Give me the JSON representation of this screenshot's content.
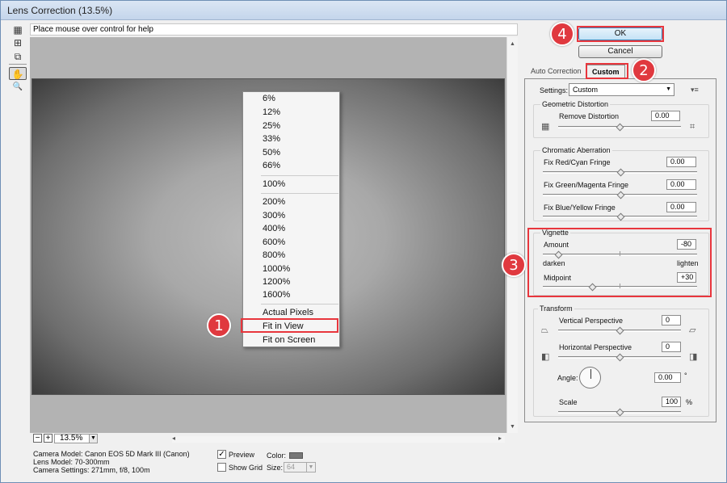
{
  "window": {
    "title": "Lens Correction (13.5%)"
  },
  "help": {
    "text": "Place mouse over control for help"
  },
  "tools": [
    {
      "icon": "remove-distortion-icon",
      "glyph": "▦"
    },
    {
      "icon": "straighten-icon",
      "glyph": "⊞"
    },
    {
      "icon": "move-grid-icon",
      "glyph": "⧉"
    },
    {
      "icon": "hand-icon",
      "glyph": "✋"
    },
    {
      "icon": "zoom-icon",
      "glyph": "🔍"
    }
  ],
  "zoom_menu": {
    "items": [
      "6%",
      "12%",
      "25%",
      "33%",
      "50%",
      "66%",
      "100%",
      "200%",
      "300%",
      "400%",
      "600%",
      "800%",
      "1000%",
      "1200%",
      "1600%",
      "Actual Pixels",
      "Fit in View",
      "Fit on Screen"
    ],
    "highlighted": "Fit in View"
  },
  "zoom": {
    "minus": "−",
    "plus": "+",
    "value": "13.5%"
  },
  "camera": {
    "model": "Camera Model: Canon EOS 5D Mark III (Canon)",
    "lens": "Lens Model: 70-300mm",
    "settings": "Camera Settings: 271mm, f/8, 100m"
  },
  "options": {
    "preview_label": "Preview",
    "preview_checked": true,
    "show_grid_label": "Show Grid",
    "show_grid_checked": false,
    "color_label": "Color:",
    "grid_color": "#777777",
    "size_label": "Size:",
    "size_value": "64"
  },
  "buttons": {
    "ok": "OK",
    "cancel": "Cancel"
  },
  "tabs": {
    "auto": "Auto Correction",
    "custom": "Custom"
  },
  "settings": {
    "label": "Settings:",
    "value": "Custom",
    "menu_icon": "▾≡"
  },
  "geometric": {
    "title": "Geometric Distortion",
    "remove_label": "Remove Distortion",
    "remove_value": "0.00",
    "remove_level": 0.5
  },
  "chromatic": {
    "title": "Chromatic Aberration",
    "red_cyan_label": "Fix Red/Cyan Fringe",
    "red_cyan_value": "0.00",
    "red_cyan_level": 0.5,
    "green_magenta_label": "Fix Green/Magenta Fringe",
    "green_magenta_value": "0.00",
    "green_magenta_level": 0.5,
    "blue_yellow_label": "Fix Blue/Yellow Fringe",
    "blue_yellow_value": "0.00",
    "blue_yellow_level": 0.5
  },
  "vignette": {
    "title": "Vignette",
    "amount_label": "Amount",
    "amount_value": "-80",
    "amount_level": 0.1,
    "darken": "darken",
    "lighten": "lighten",
    "midpoint_label": "Midpoint",
    "midpoint_value": "+30",
    "midpoint_level": 0.32
  },
  "transform": {
    "title": "Transform",
    "vertical_label": "Vertical Perspective",
    "vertical_value": "0",
    "vertical_level": 0.5,
    "horizontal_label": "Horizontal Perspective",
    "horizontal_value": "0",
    "horizontal_level": 0.5,
    "angle_label": "Angle:",
    "angle_value": "0.00",
    "angle_unit": "°",
    "scale_label": "Scale",
    "scale_value": "100",
    "scale_unit": "%",
    "scale_level": 0.5
  },
  "callouts": [
    "1",
    "2",
    "3",
    "4"
  ],
  "colors": {
    "highlight": "#e8363d",
    "ok_border": "#3c7fb1"
  }
}
